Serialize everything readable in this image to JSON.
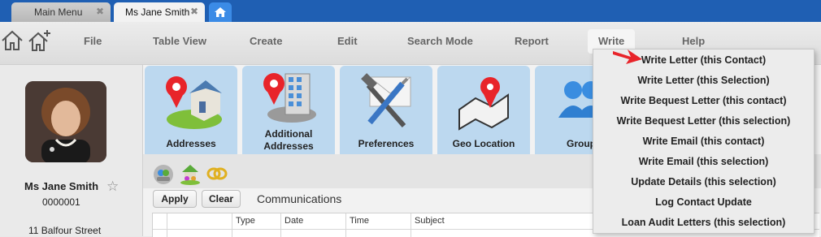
{
  "tabs": [
    {
      "label": "Main Menu",
      "close": "✖"
    },
    {
      "label": "Ms Jane Smith",
      "close": "✖"
    }
  ],
  "menu": {
    "file": "File",
    "table_view": "Table View",
    "create": "Create",
    "edit": "Edit",
    "search_mode": "Search Mode",
    "report": "Report",
    "write": "Write",
    "help": "Help"
  },
  "contact": {
    "name": "Ms Jane Smith",
    "id": "0000001",
    "address": "11 Balfour Street"
  },
  "tiles": [
    {
      "label": "Addresses",
      "icon": "house-pin-icon"
    },
    {
      "label_line1": "Additional",
      "label_line2": "Addresses",
      "icon": "building-pin-icon"
    },
    {
      "label": "Preferences",
      "icon": "tools-icon"
    },
    {
      "label": "Geo Location",
      "icon": "map-pin-icon"
    },
    {
      "label": "Group",
      "icon": "people-icon"
    }
  ],
  "toolbar": {
    "apply": "Apply",
    "clear": "Clear",
    "section": "Communications"
  },
  "table": {
    "columns": [
      "",
      "",
      "Type",
      "Date",
      "Time",
      "Subject"
    ]
  },
  "write_menu": [
    "Write Letter (this Contact)",
    "Write Letter (this Selection)",
    "Write Bequest Letter (this contact)",
    "Write Bequest Letter (this selection)",
    "Write Email (this contact)",
    "Write Email (this selection)",
    "Update Details (this selection)",
    "Log Contact Update",
    "Loan Audit Letters (this selection)"
  ],
  "colors": {
    "titlebar": "#1f5fb3",
    "tile": "#bcd8ef",
    "arrow": "#e8242a"
  }
}
